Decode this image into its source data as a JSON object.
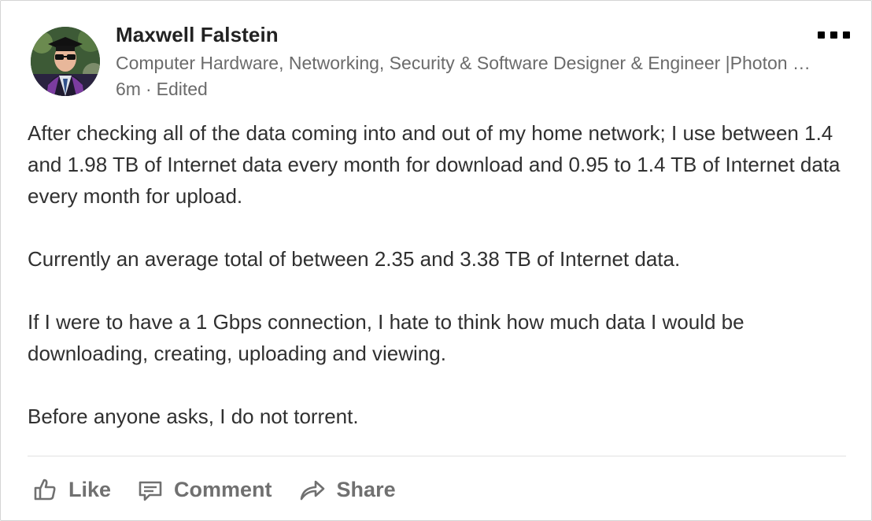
{
  "post": {
    "author": {
      "name": "Maxwell Falstein",
      "headline": "Computer Hardware, Networking, Security & Software Designer & Engineer |Photon …",
      "time": "6m",
      "separator": "·",
      "edited_label": "Edited",
      "avatar_icon": "profile-photo-graduate"
    },
    "menu_icon": "more-options-icon",
    "paragraphs": [
      "After checking all of the data coming into and out of my home network; I use between 1.4 and 1.98 TB of Internet data every month for download and 0.95 to 1.4 TB of Internet data every month for upload.",
      "Currently an average total of between 2.35 and 3.38 TB of Internet data.",
      "If I were to have a 1 Gbps connection, I hate to think how much data I would be downloading, creating, uploading and viewing.",
      "Before anyone asks, I do not torrent."
    ],
    "actions": {
      "like": {
        "label": "Like",
        "icon": "thumbs-up-icon"
      },
      "comment": {
        "label": "Comment",
        "icon": "comment-icon"
      },
      "share": {
        "label": "Share",
        "icon": "share-arrow-icon"
      }
    }
  },
  "colors": {
    "name_text": "#222222",
    "secondary_text": "#6b6b6b",
    "body_text": "#303030",
    "action_text": "#707070",
    "border": "#d4d4d4"
  }
}
